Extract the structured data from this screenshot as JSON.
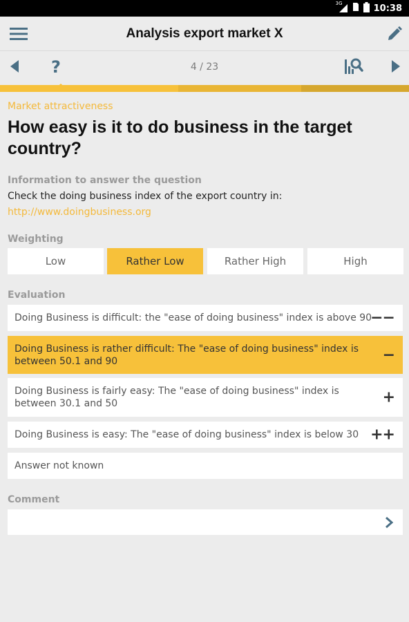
{
  "status_bar": {
    "network": "3G",
    "time": "10:38"
  },
  "app_bar": {
    "title": "Analysis export market X",
    "menu_icon": "hamburger-icon",
    "edit_icon": "pencil-icon"
  },
  "nav_bar": {
    "counter": "4 / 23",
    "help_label": "?",
    "prev_icon": "triangle-left-icon",
    "next_icon": "triangle-right-icon",
    "chart_icon": "chart-search-icon"
  },
  "progress": {
    "current": 4,
    "total": 23
  },
  "colors": {
    "accent": "#f7c13a",
    "accent_text": "#f4b93b",
    "icon": "#4a6f85"
  },
  "question": {
    "category": "Market attractiveness",
    "title": "How easy is it to do business in the target country?",
    "info_label": "Information to answer the question",
    "info_text": "Check the doing business index of the export country in:",
    "info_link": "http://www.doingbusiness.org"
  },
  "weighting": {
    "label": "Weighting",
    "options": [
      "Low",
      "Rather Low",
      "Rather High",
      "High"
    ],
    "selected": "Rather Low"
  },
  "evaluation": {
    "label": "Evaluation",
    "items": [
      {
        "text": "Doing Business is difficult: the \"ease of doing business\" index is above 90",
        "symbol": "−−"
      },
      {
        "text": "Doing Business is rather difficult: The \"ease of doing business\" index is between 50.1 and 90",
        "symbol": "−"
      },
      {
        "text": "Doing Business is fairly easy: The \"ease of doing business\" index is between 30.1 and 50",
        "symbol": "+"
      },
      {
        "text": "Doing Business is easy: The \"ease of doing business\" index is below 30",
        "symbol": "++"
      },
      {
        "text": "Answer not known",
        "symbol": ""
      }
    ],
    "selected_index": 1
  },
  "comment": {
    "label": "Comment",
    "value": ""
  }
}
